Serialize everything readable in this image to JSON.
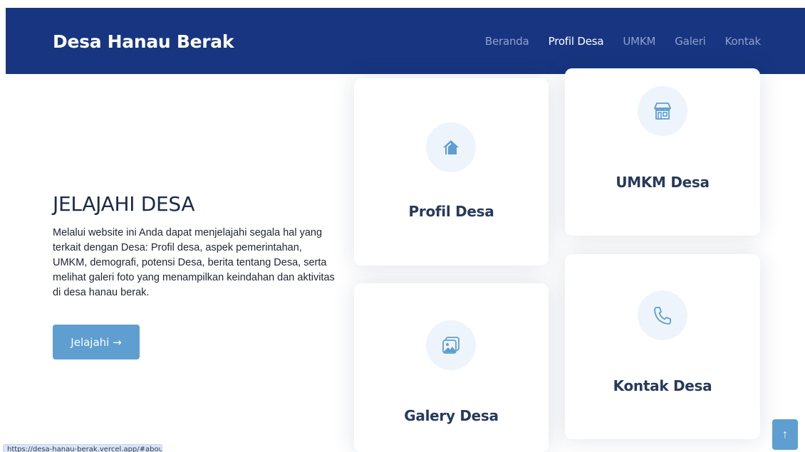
{
  "header": {
    "brand": "Desa Hanau Berak",
    "nav": [
      {
        "label": "Beranda",
        "active": false
      },
      {
        "label": "Profil Desa",
        "active": true
      },
      {
        "label": "UMKM",
        "active": false
      },
      {
        "label": "Galeri",
        "active": false
      },
      {
        "label": "Kontak",
        "active": false
      }
    ]
  },
  "hero": {
    "title": "JELAJAHI DESA",
    "description": "Melalui website ini Anda dapat menjelajahi segala hal yang terkait dengan Desa: Profil desa, aspek pemerintahan, UMKM, demografi, potensi Desa, berita tentang Desa, serta melihat galeri foto yang menampilkan keindahan dan aktivitas di desa hanau berak.",
    "cta_label": "Jelajahi →"
  },
  "cards": [
    {
      "title": "Profil Desa",
      "icon": "home-icon"
    },
    {
      "title": "UMKM Desa",
      "icon": "store-icon"
    },
    {
      "title": "Galery Desa",
      "icon": "image-icon"
    },
    {
      "title": "Kontak Desa",
      "icon": "phone-icon"
    }
  ],
  "status_bar": {
    "url": "https://desa-hanau-berak.vercel.app/#about"
  },
  "back_to_top": {
    "label": "↑"
  },
  "colors": {
    "navbar": "#173580",
    "accent": "#5f9ed1",
    "icon_circle": "#eef4fb",
    "icon_color": "#5f9ed1"
  }
}
